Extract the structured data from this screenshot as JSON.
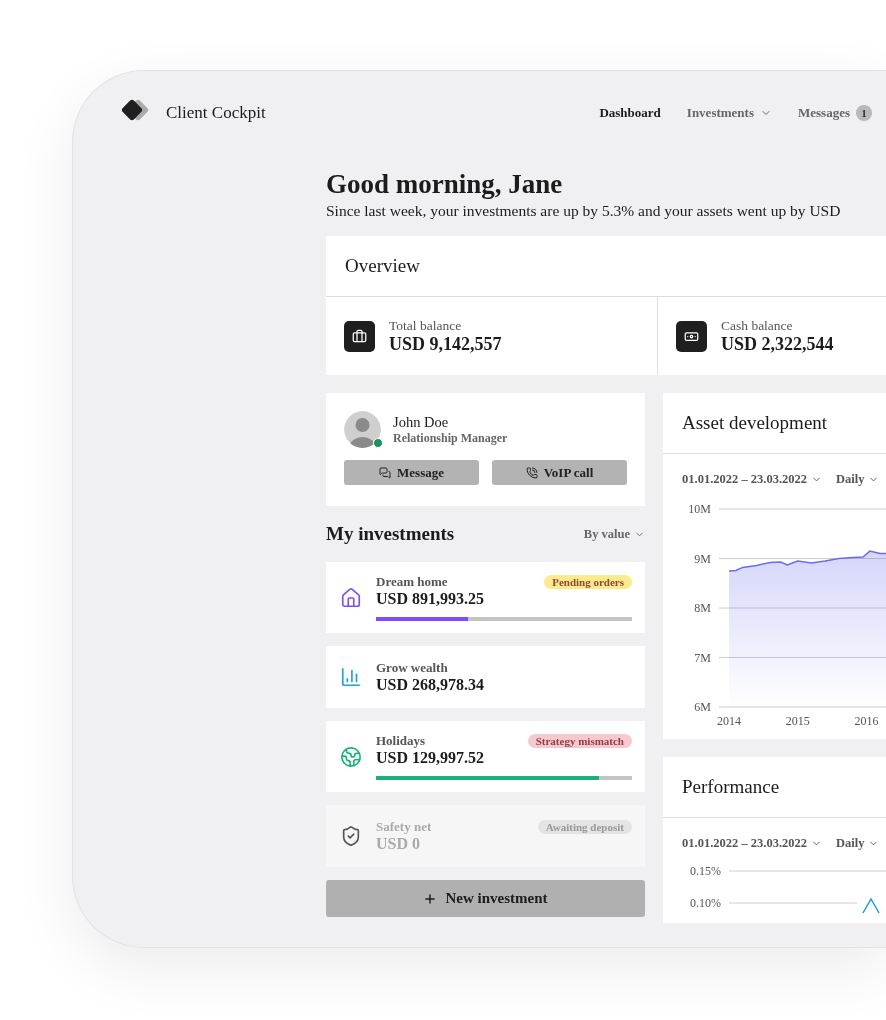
{
  "brand": {
    "name": "Client Cockpit"
  },
  "nav": [
    {
      "label": "Dashboard",
      "selected": true,
      "kind": "link"
    },
    {
      "label": "Investments",
      "selected": false,
      "kind": "menu"
    },
    {
      "label": "Messages",
      "selected": false,
      "kind": "badge",
      "count": "1"
    }
  ],
  "greeting": {
    "title": "Good morning, Jane",
    "subtitle": "Since last week, your investments are up by 5.3% and your assets went up by USD"
  },
  "overview": {
    "title": "Overview",
    "stats": [
      {
        "kind": "briefcase",
        "label": "Total balance",
        "value": "USD 9,142,557"
      },
      {
        "kind": "cash",
        "label": "Cash balance",
        "value": "USD 2,322,544"
      }
    ]
  },
  "manager": {
    "name": "John Doe",
    "role": "Relationship Manager",
    "online": true,
    "buttons": [
      {
        "kind": "message",
        "label": "Message"
      },
      {
        "kind": "call",
        "label": "VoIP call"
      }
    ]
  },
  "investments": {
    "title": "My investments",
    "sort": "By value",
    "items": [
      {
        "kind": "home",
        "name": "Dream home",
        "value": "USD 891,993.25",
        "color": "#7c4dff",
        "badge": {
          "text": "Pending orders",
          "color": "#fbeb8c"
        },
        "level": 0.36,
        "disabled": false
      },
      {
        "kind": "chart",
        "name": "Grow wealth",
        "value": "USD 268,978.34",
        "color": "#1a9fe0",
        "disabled": false
      },
      {
        "kind": "globe",
        "name": "Holidays",
        "value": "USD 129,997.52",
        "color": "#16b27a",
        "badge": {
          "text": "Strategy mismatch",
          "color": "#f6c9cf"
        },
        "level": 0.87,
        "disabled": false
      },
      {
        "kind": "shield",
        "name": "Safety net",
        "value": "USD 0",
        "color": "#555555",
        "badge": {
          "text": "Awaiting deposit",
          "color": "#e4e4e4"
        },
        "disabled": true
      }
    ],
    "add_button": "New investment"
  },
  "asset_development": {
    "title": "Asset development",
    "period": "01.01.2022 – 23.03.2022",
    "interval": "Daily",
    "chart_data": {
      "type": "area",
      "x": [
        2014,
        2014.1,
        2014.2,
        2014.4,
        2014.6,
        2014.75,
        2014.85,
        2015,
        2015.2,
        2015.4,
        2015.6,
        2015.8,
        2015.95,
        2016.05,
        2016.2,
        2016.3
      ],
      "grid": true,
      "series": [
        {
          "color": "#6b6bf0",
          "values": [
            8.75,
            8.76,
            8.82,
            8.86,
            8.92,
            8.93,
            8.87,
            8.95,
            8.91,
            8.95,
            9.0,
            9.02,
            9.03,
            9.15,
            9.1,
            9.1
          ]
        }
      ],
      "ylim": [
        6,
        10
      ],
      "xlim": [
        2014,
        2016.3
      ],
      "yticks": [
        {
          "value": 6,
          "label": "6M"
        },
        {
          "value": 7,
          "label": "7M"
        },
        {
          "value": 8,
          "label": "8M"
        },
        {
          "value": 9,
          "label": "9M"
        },
        {
          "value": 10,
          "label": "10M"
        }
      ],
      "xticks": [
        2014,
        2015,
        2016
      ]
    }
  },
  "performance": {
    "title": "Performance",
    "period": "01.01.2022 – 23.03.2022",
    "interval": "Daily",
    "axis_labels": [
      "0.15%",
      "0.10%"
    ]
  }
}
